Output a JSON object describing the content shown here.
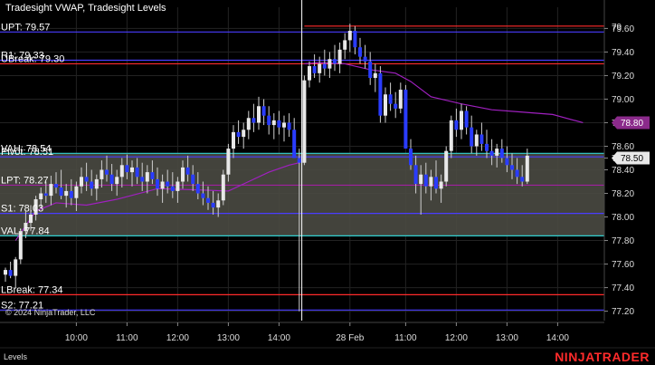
{
  "window": {
    "title": "Tradesight VWAP, Tradesight Levels",
    "tab": "Levels",
    "copyright": "© 2024 NinjaTrader, LLC",
    "brand": "NINJATRADER"
  },
  "chart_data": {
    "type": "candlestick",
    "ylim": [
      77.12,
      79.78
    ],
    "yticks": [
      {
        "v": 79.6,
        "label": "79.60"
      },
      {
        "v": 79.4,
        "label": "79.40"
      },
      {
        "v": 79.2,
        "label": "79.20"
      },
      {
        "v": 79.0,
        "label": "79.00"
      },
      {
        "v": 78.8,
        "label": "78.80"
      },
      {
        "v": 78.6,
        "label": "78.60"
      },
      {
        "v": 78.5,
        "label": "78.50"
      },
      {
        "v": 78.4,
        "label": "78.40"
      },
      {
        "v": 78.2,
        "label": "78.20"
      },
      {
        "v": 78.0,
        "label": "78.00"
      },
      {
        "v": 77.8,
        "label": "77.80"
      },
      {
        "v": 77.6,
        "label": "77.60"
      },
      {
        "v": 77.4,
        "label": "77.40"
      },
      {
        "v": 77.2,
        "label": "77.20"
      }
    ],
    "xticks": [
      {
        "i": 14,
        "label": "10:00"
      },
      {
        "i": 24,
        "label": "11:00"
      },
      {
        "i": 34,
        "label": "12:00"
      },
      {
        "i": 44,
        "label": "13:00"
      },
      {
        "i": 54,
        "label": "14:00"
      },
      {
        "i": 68,
        "label": "28 Feb"
      },
      {
        "i": 79,
        "label": "11:00"
      },
      {
        "i": 89,
        "label": "12:00"
      },
      {
        "i": 99,
        "label": "13:00"
      },
      {
        "i": 109,
        "label": "14:00"
      }
    ],
    "session_break_index": 59,
    "levels": [
      {
        "name": "UPT",
        "label": "UPT: 79.57",
        "v": 79.57,
        "color": "#4a3cff"
      },
      {
        "name": "R1",
        "label": "R1: 79.33",
        "v": 79.33,
        "color": "#4a3cff"
      },
      {
        "name": "UBreak",
        "label": "UBreak: 79.30",
        "v": 79.3,
        "color": "#ff2b2b"
      },
      {
        "name": "VAH",
        "label": "VAH: 78.54",
        "v": 78.54,
        "color": "#30d0d0"
      },
      {
        "name": "Pivot",
        "label": "Pivot: 78.51",
        "v": 78.51,
        "color": "#4a3cff"
      },
      {
        "name": "LPT",
        "label": "LPT: 78.27",
        "v": 78.27,
        "color": "#a020a0"
      },
      {
        "name": "S1",
        "label": "S1: 78.03",
        "v": 78.03,
        "color": "#4a3cff"
      },
      {
        "name": "VAL",
        "label": "VAL: 77.84",
        "v": 77.84,
        "color": "#30d0d0"
      },
      {
        "name": "LBreak",
        "label": "LBreak: 77.34",
        "v": 77.34,
        "color": "#ff2b2b"
      },
      {
        "name": "S2",
        "label": "S2: 77.21",
        "v": 77.21,
        "color": "#4a3cff"
      }
    ],
    "value_area": {
      "high": 78.54,
      "low": 77.84,
      "color": "#4a4a42"
    },
    "extra_line": {
      "v": 79.62,
      "color": "#ff2b2b",
      "start_index": 59,
      "label": "79"
    },
    "price_tags": [
      {
        "v": 78.8,
        "label": "78.80",
        "bg": "#8b2a8b",
        "fg": "#ffffff"
      },
      {
        "v": 78.5,
        "label": "78.50",
        "bg": "#e8e8e8",
        "fg": "#000000"
      }
    ],
    "vwap": [
      {
        "i": 2,
        "v": 77.8
      },
      {
        "i": 6,
        "v": 78.05
      },
      {
        "i": 10,
        "v": 78.12
      },
      {
        "i": 16,
        "v": 78.1
      },
      {
        "i": 22,
        "v": 78.15
      },
      {
        "i": 30,
        "v": 78.24
      },
      {
        "i": 38,
        "v": 78.23
      },
      {
        "i": 44,
        "v": 78.22
      },
      {
        "i": 48,
        "v": 78.3
      },
      {
        "i": 52,
        "v": 78.38
      },
      {
        "i": 56,
        "v": 78.44
      },
      {
        "i": 58,
        "v": 78.46
      },
      {
        "i": 59,
        "v": 79.3
      },
      {
        "i": 62,
        "v": 79.31
      },
      {
        "i": 67,
        "v": 79.3
      },
      {
        "i": 72,
        "v": 79.25
      },
      {
        "i": 77,
        "v": 79.22
      },
      {
        "i": 80,
        "v": 79.15
      },
      {
        "i": 84,
        "v": 79.02
      },
      {
        "i": 90,
        "v": 78.96
      },
      {
        "i": 96,
        "v": 78.91
      },
      {
        "i": 102,
        "v": 78.89
      },
      {
        "i": 108,
        "v": 78.87
      },
      {
        "i": 114,
        "v": 78.8
      }
    ],
    "candles": [
      [
        77.51,
        77.57,
        77.45,
        77.55
      ],
      [
        77.55,
        77.62,
        77.48,
        77.5
      ],
      [
        77.5,
        77.66,
        77.4,
        77.64
      ],
      [
        77.64,
        77.9,
        77.6,
        77.88
      ],
      [
        77.88,
        78.05,
        77.82,
        77.95
      ],
      [
        77.95,
        78.1,
        77.88,
        78.02
      ],
      [
        78.02,
        78.18,
        77.97,
        78.15
      ],
      [
        78.15,
        78.25,
        78.08,
        78.2
      ],
      [
        78.2,
        78.3,
        78.12,
        78.18
      ],
      [
        78.18,
        78.35,
        78.1,
        78.28
      ],
      [
        78.28,
        78.38,
        78.2,
        78.25
      ],
      [
        78.25,
        78.4,
        78.15,
        78.18
      ],
      [
        78.18,
        78.28,
        78.08,
        78.22
      ],
      [
        78.22,
        78.32,
        78.1,
        78.16
      ],
      [
        78.16,
        78.3,
        78.05,
        78.26
      ],
      [
        78.26,
        78.42,
        78.2,
        78.34
      ],
      [
        78.34,
        78.46,
        78.22,
        78.3
      ],
      [
        78.3,
        78.4,
        78.18,
        78.24
      ],
      [
        78.24,
        78.36,
        78.14,
        78.32
      ],
      [
        78.32,
        78.48,
        78.25,
        78.4
      ],
      [
        78.4,
        78.52,
        78.3,
        78.36
      ],
      [
        78.36,
        78.45,
        78.22,
        78.28
      ],
      [
        78.28,
        78.4,
        78.18,
        78.34
      ],
      [
        78.34,
        78.5,
        78.25,
        78.44
      ],
      [
        78.44,
        78.53,
        78.32,
        78.38
      ],
      [
        78.38,
        78.48,
        78.26,
        78.42
      ],
      [
        78.42,
        78.5,
        78.28,
        78.34
      ],
      [
        78.34,
        78.46,
        78.22,
        78.3
      ],
      [
        78.3,
        78.44,
        78.2,
        78.38
      ],
      [
        78.38,
        78.48,
        78.28,
        78.32
      ],
      [
        78.32,
        78.42,
        78.18,
        78.24
      ],
      [
        78.24,
        78.36,
        78.12,
        78.3
      ],
      [
        78.3,
        78.4,
        78.2,
        78.26
      ],
      [
        78.26,
        78.38,
        78.16,
        78.22
      ],
      [
        78.22,
        78.34,
        78.12,
        78.3
      ],
      [
        78.3,
        78.48,
        78.24,
        78.42
      ],
      [
        78.42,
        78.52,
        78.3,
        78.36
      ],
      [
        78.36,
        78.44,
        78.22,
        78.28
      ],
      [
        78.28,
        78.38,
        78.15,
        78.2
      ],
      [
        78.2,
        78.3,
        78.1,
        78.16
      ],
      [
        78.16,
        78.26,
        78.06,
        78.12
      ],
      [
        78.12,
        78.22,
        78.02,
        78.08
      ],
      [
        78.08,
        78.2,
        78.0,
        78.14
      ],
      [
        78.14,
        78.4,
        78.1,
        78.36
      ],
      [
        78.36,
        78.62,
        78.3,
        78.58
      ],
      [
        78.58,
        78.78,
        78.5,
        78.72
      ],
      [
        78.72,
        78.82,
        78.62,
        78.68
      ],
      [
        78.68,
        78.8,
        78.58,
        78.74
      ],
      [
        78.74,
        78.9,
        78.66,
        78.84
      ],
      [
        78.84,
        78.96,
        78.72,
        78.8
      ],
      [
        78.8,
        79.02,
        78.74,
        78.94
      ],
      [
        78.94,
        79.0,
        78.78,
        78.86
      ],
      [
        78.86,
        78.94,
        78.7,
        78.78
      ],
      [
        78.78,
        78.88,
        78.66,
        78.82
      ],
      [
        78.82,
        78.9,
        78.7,
        78.76
      ],
      [
        78.76,
        78.86,
        78.64,
        78.8
      ],
      [
        78.8,
        78.88,
        78.68,
        78.74
      ],
      [
        78.74,
        78.84,
        78.6,
        78.5
      ],
      [
        78.5,
        78.58,
        77.2,
        78.46
      ],
      [
        78.46,
        79.2,
        78.44,
        79.16
      ],
      [
        79.16,
        79.32,
        79.1,
        79.28
      ],
      [
        79.28,
        79.38,
        79.18,
        79.22
      ],
      [
        79.22,
        79.36,
        79.14,
        79.3
      ],
      [
        79.3,
        79.42,
        79.2,
        79.26
      ],
      [
        79.26,
        79.4,
        79.18,
        79.34
      ],
      [
        79.34,
        79.46,
        79.24,
        79.3
      ],
      [
        79.3,
        79.48,
        79.22,
        79.42
      ],
      [
        79.42,
        79.56,
        79.34,
        79.5
      ],
      [
        79.5,
        79.64,
        79.4,
        79.58
      ],
      [
        79.58,
        79.62,
        79.38,
        79.44
      ],
      [
        79.44,
        79.52,
        79.3,
        79.36
      ],
      [
        79.36,
        79.46,
        79.26,
        79.32
      ],
      [
        79.32,
        79.4,
        79.12,
        79.18
      ],
      [
        79.18,
        79.3,
        79.06,
        79.22
      ],
      [
        79.22,
        79.28,
        78.8,
        78.86
      ],
      [
        78.86,
        79.1,
        78.8,
        79.04
      ],
      [
        79.04,
        79.14,
        78.9,
        78.96
      ],
      [
        78.96,
        79.06,
        78.84,
        78.92
      ],
      [
        78.92,
        79.14,
        78.88,
        79.08
      ],
      [
        79.08,
        79.12,
        78.62,
        78.58
      ],
      [
        78.58,
        78.66,
        78.4,
        78.44
      ],
      [
        78.44,
        78.52,
        78.2,
        78.28
      ],
      [
        78.28,
        78.44,
        78.02,
        78.36
      ],
      [
        78.36,
        78.46,
        78.2,
        78.26
      ],
      [
        78.26,
        78.4,
        78.14,
        78.34
      ],
      [
        78.34,
        78.48,
        78.2,
        78.24
      ],
      [
        78.24,
        78.36,
        78.12,
        78.3
      ],
      [
        78.3,
        78.6,
        78.26,
        78.56
      ],
      [
        78.56,
        78.86,
        78.5,
        78.82
      ],
      [
        78.82,
        78.92,
        78.68,
        78.74
      ],
      [
        78.74,
        78.96,
        78.66,
        78.9
      ],
      [
        78.9,
        78.94,
        78.7,
        78.76
      ],
      [
        78.76,
        78.86,
        78.54,
        78.6
      ],
      [
        78.6,
        78.74,
        78.52,
        78.7
      ],
      [
        78.7,
        78.8,
        78.56,
        78.62
      ],
      [
        78.62,
        78.74,
        78.5,
        78.56
      ],
      [
        78.56,
        78.66,
        78.44,
        78.52
      ],
      [
        78.52,
        78.62,
        78.42,
        78.58
      ],
      [
        78.58,
        78.66,
        78.46,
        78.5
      ],
      [
        78.5,
        78.6,
        78.38,
        78.44
      ],
      [
        78.44,
        78.54,
        78.32,
        78.4
      ],
      [
        78.4,
        78.5,
        78.28,
        78.34
      ],
      [
        78.34,
        78.44,
        78.26,
        78.3
      ],
      [
        78.3,
        78.58,
        78.28,
        78.52
      ]
    ]
  }
}
